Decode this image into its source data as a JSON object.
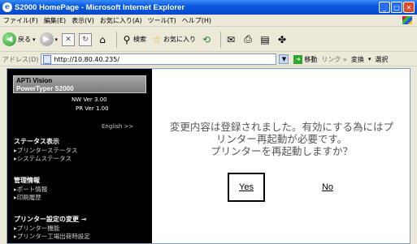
{
  "window": {
    "title": "S2000 HomePage - Microsoft Internet Explorer",
    "buttons": [
      "minimize",
      "maximize",
      "close"
    ]
  },
  "menubar": {
    "items": [
      "ファイル(F)",
      "編集(E)",
      "表示(V)",
      "お気に入り(A)",
      "ツール(T)",
      "ヘルプ(H)"
    ]
  },
  "toolbar": {
    "back_label": "戻る",
    "search_label": "検索",
    "favorites_label": "お気に入り"
  },
  "addressbar": {
    "label": "アドレス(D)",
    "url": "http://10.80.40.235/",
    "go_label": "移動",
    "links_label": "リンク »",
    "translate_label": "変換",
    "select_label": "選択"
  },
  "sidebar": {
    "product_line1": "APTi Vision",
    "product_line2": "PowerTyper S2000",
    "nw_version": "NW Ver 3.00",
    "pr_version": "PR Ver 1.00",
    "english_link": "English >>",
    "sections": [
      {
        "title": "ステータス表示",
        "items": [
          "▸プリンターステータス",
          "▸システムステータス"
        ]
      },
      {
        "title": "管理情報",
        "items": [
          "▸ポート情報",
          "▸印刷履歴"
        ]
      },
      {
        "title": "プリンター設定の変更",
        "items": [
          "▸プリンター機能",
          "▸プリンター工場出荷時設定"
        ]
      }
    ]
  },
  "dialog": {
    "message_line1": "変更内容は登録されました。有効にする為にはプ",
    "message_line2": "リンター再起動が必要です。",
    "message_line3": "プリンターを再起動しますか？",
    "yes_label": "Yes",
    "no_label": "No"
  },
  "colors": {
    "titlebar": "#0a5adf",
    "sidebar_bg": "#000000",
    "message_text": "#555555"
  }
}
